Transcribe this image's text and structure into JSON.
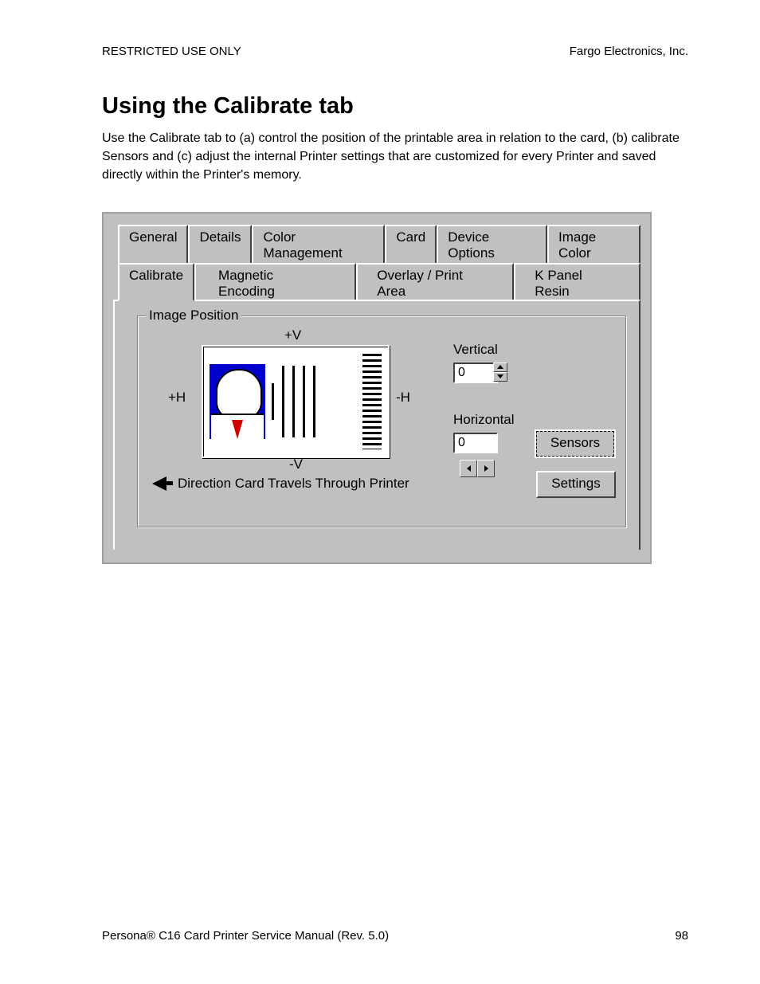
{
  "header": {
    "left": "RESTRICTED USE ONLY",
    "right": "Fargo Electronics, Inc."
  },
  "section": {
    "title": "Using the Calibrate tab",
    "body": "Use the Calibrate tab to (a) control the position of the printable area in relation to the card, (b) calibrate Sensors and (c) adjust the internal Printer settings that are customized for every Printer and saved directly within the Printer's memory."
  },
  "dialog": {
    "tabs_row1": [
      "General",
      "Details",
      "Color Management",
      "Card",
      "Device Options",
      "Image Color"
    ],
    "tabs_row2": [
      "Calibrate",
      "Magnetic Encoding",
      "Overlay / Print Area",
      "K Panel Resin"
    ],
    "active_tab": "Calibrate",
    "group": {
      "legend": "Image Position",
      "axis": {
        "plusV": "+V",
        "minusV": "-V",
        "plusH": "+H",
        "minusH": "-H"
      },
      "direction": "Direction Card Travels Through Printer",
      "vertical_label": "Vertical",
      "vertical_value": "0",
      "horizontal_label": "Horizontal",
      "horizontal_value": "0",
      "sensors_btn": "Sensors",
      "settings_btn": "Settings"
    }
  },
  "footer": {
    "left": "Persona® C16 Card Printer Service Manual (Rev. 5.0)",
    "right": "98"
  }
}
